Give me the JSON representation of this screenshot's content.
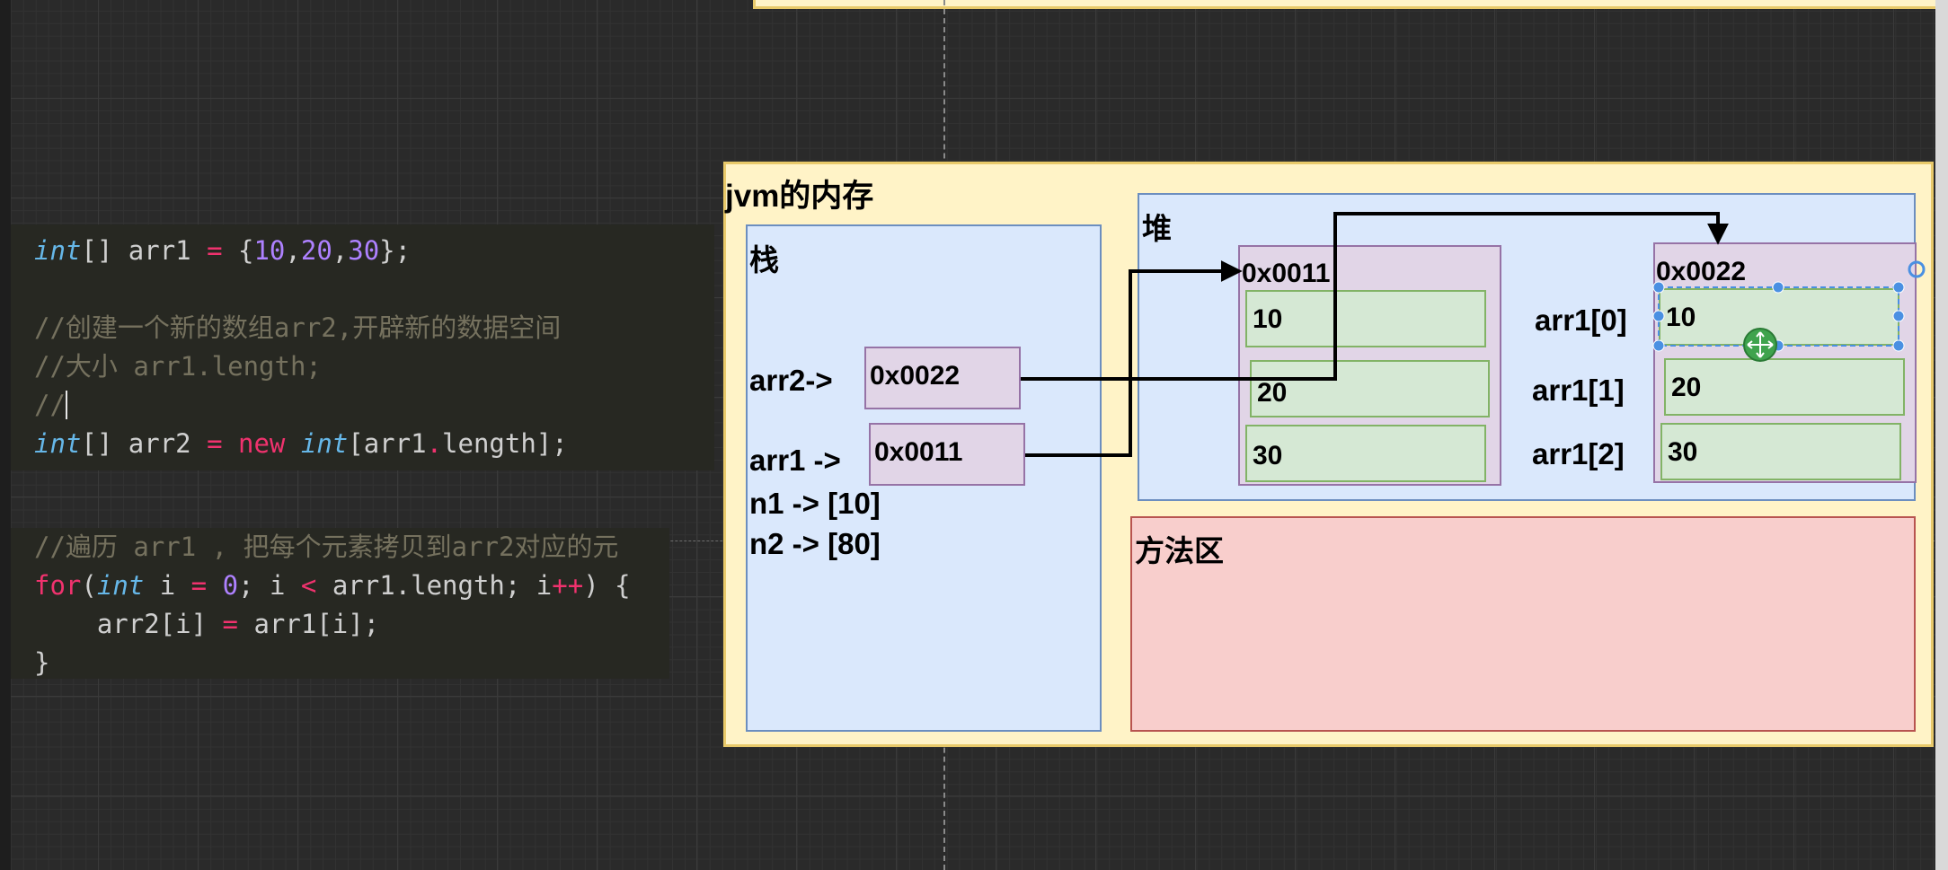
{
  "code_block_1": {
    "lines": [
      [
        {
          "t": "int",
          "c": "kw-type"
        },
        {
          "t": "[] arr1 "
        },
        {
          "t": "=",
          "c": "op"
        },
        {
          "t": " {"
        },
        {
          "t": "10",
          "c": "num"
        },
        {
          "t": ","
        },
        {
          "t": "20",
          "c": "num"
        },
        {
          "t": ","
        },
        {
          "t": "30",
          "c": "num"
        },
        {
          "t": "};"
        }
      ],
      [],
      [
        {
          "t": "//创建一个新的数组arr2,开辟新的数据空间",
          "c": "cmt"
        }
      ],
      [
        {
          "t": "//大小 arr1.length;",
          "c": "cmt"
        }
      ],
      [
        {
          "t": "//",
          "c": "cmt"
        },
        {
          "t": "",
          "c": "cursor"
        }
      ],
      [
        {
          "t": "int",
          "c": "kw-type"
        },
        {
          "t": "[] arr2 "
        },
        {
          "t": "=",
          "c": "op"
        },
        {
          "t": " "
        },
        {
          "t": "new",
          "c": "kw-red"
        },
        {
          "t": " "
        },
        {
          "t": "int",
          "c": "kw-type"
        },
        {
          "t": "[arr1"
        },
        {
          "t": ".",
          "c": "op"
        },
        {
          "t": "length];"
        }
      ]
    ]
  },
  "code_block_2": {
    "lines": [
      [
        {
          "t": "//遍历 arr1 , 把每个元素拷贝到arr2对应的元",
          "c": "cmt"
        }
      ],
      [
        {
          "t": "for",
          "c": "kw-red"
        },
        {
          "t": "("
        },
        {
          "t": "int",
          "c": "kw-type"
        },
        {
          "t": " i "
        },
        {
          "t": "=",
          "c": "op"
        },
        {
          "t": " "
        },
        {
          "t": "0",
          "c": "num"
        },
        {
          "t": "; i "
        },
        {
          "t": "<",
          "c": "op"
        },
        {
          "t": " arr1.length; i"
        },
        {
          "t": "++",
          "c": "op"
        },
        {
          "t": ") {"
        }
      ],
      [
        {
          "t": "    arr2[i] "
        },
        {
          "t": "=",
          "c": "op"
        },
        {
          "t": " arr1[i];"
        }
      ],
      [
        {
          "t": "}"
        }
      ]
    ]
  },
  "diagram": {
    "title": "jvm的内存",
    "stack": {
      "label": "栈",
      "arr2_label": "arr2->",
      "arr2_ref": "0x0022",
      "arr1_label": "arr1 ->",
      "arr1_ref": "0x0011",
      "n1": "n1 -> [10]",
      "n2": "n2 -> [80]"
    },
    "heap": {
      "label": "堆",
      "array1": {
        "address": "0x0011",
        "cells": [
          "10",
          "20",
          "30"
        ]
      },
      "array2": {
        "address": "0x0022",
        "cells": [
          "10",
          "20",
          "30"
        ]
      },
      "index_labels": [
        "arr1[0]",
        "arr1[1]",
        "arr1[2]"
      ]
    },
    "method_area": {
      "label": "方法区"
    }
  },
  "colors": {
    "canvas": "#2a2a2a",
    "code_bg": "#272822",
    "jvm_bg": "#fff3c7",
    "panel_blue": "#dae8fc",
    "panel_red": "#f8cecc",
    "box_purple": "#e1d5e7",
    "cell_green": "#d5e8d4",
    "selection": "#4a90e2"
  }
}
